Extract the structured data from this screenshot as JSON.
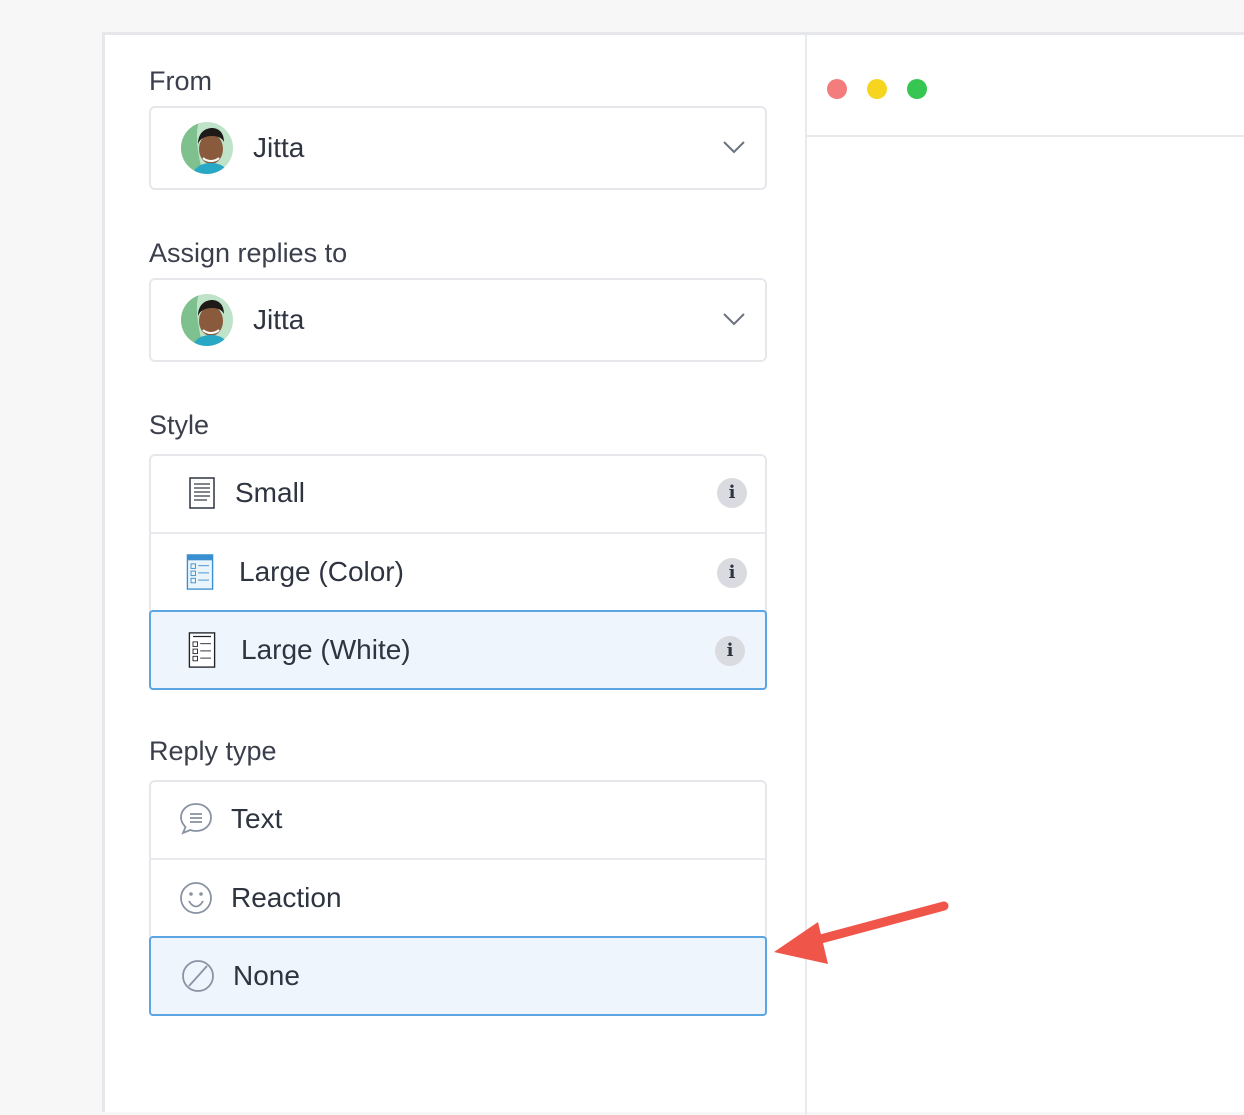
{
  "from": {
    "label": "From",
    "value": "Jitta"
  },
  "assign": {
    "label": "Assign replies to",
    "value": "Jitta"
  },
  "style": {
    "label": "Style",
    "options": [
      {
        "label": "Small",
        "icon": "document-small-icon",
        "info": "i"
      },
      {
        "label": "Large (Color)",
        "icon": "document-large-color-icon",
        "info": "i"
      },
      {
        "label": "Large (White)",
        "icon": "document-large-white-icon",
        "info": "i",
        "selected": true
      }
    ]
  },
  "reply_type": {
    "label": "Reply type",
    "options": [
      {
        "label": "Text",
        "icon": "speech-bubble-icon"
      },
      {
        "label": "Reaction",
        "icon": "smiley-icon"
      },
      {
        "label": "None",
        "icon": "prohibited-icon",
        "selected": true
      }
    ]
  },
  "window_controls": [
    "close",
    "minimize",
    "maximize"
  ],
  "colors": {
    "accent": "#5ba5e3",
    "selected_bg": "#eef5fd",
    "arrow": "#f0554a"
  }
}
